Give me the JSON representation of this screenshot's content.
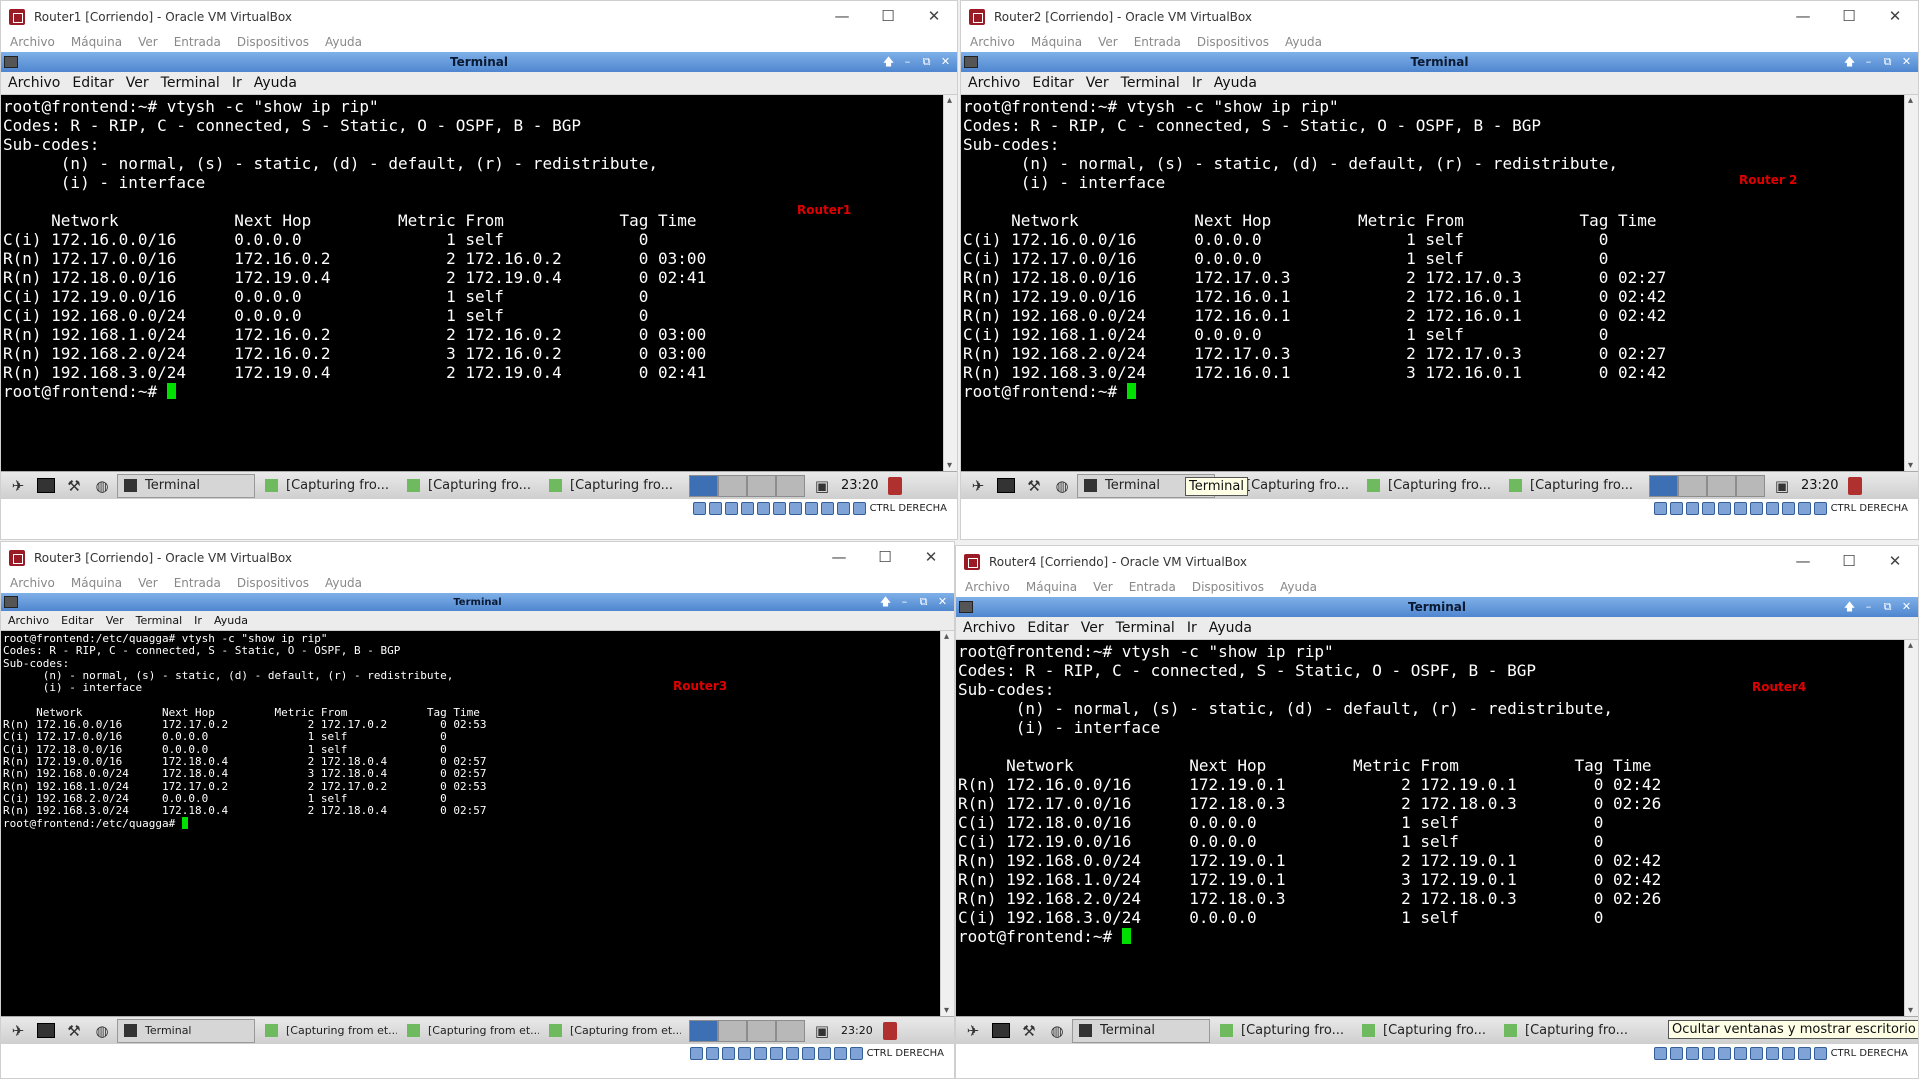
{
  "colors": {
    "terminal_bg": "#000000",
    "terminal_fg": "#ffffff",
    "cursor": "#00e000",
    "label_red": "#e00000",
    "titlebar_blue": "#4f86cf"
  },
  "vbox_menu": [
    "Archivo",
    "Máquina",
    "Ver",
    "Entrada",
    "Dispositivos",
    "Ayuda"
  ],
  "term_menu": [
    "Archivo",
    "Editar",
    "Ver",
    "Terminal",
    "Ir",
    "Ayuda"
  ],
  "term_window_title": "Terminal",
  "host_key": "CTRL DERECHA",
  "panel_clock": "23:20",
  "win_controls": [
    "—",
    "☐",
    "✕"
  ],
  "vms": [
    {
      "window_title": "Router1 [Corriendo] - Oracle VM VirtualBox",
      "label": "Router1",
      "lines": [
        "root@frontend:~# vtysh -c \"show ip rip\"",
        "Codes: R - RIP, C - connected, S - Static, O - OSPF, B - BGP",
        "Sub-codes:",
        "      (n) - normal, (s) - static, (d) - default, (r) - redistribute,",
        "      (i) - interface",
        "",
        "     Network            Next Hop         Metric From            Tag Time",
        "C(i) 172.16.0.0/16      0.0.0.0               1 self              0",
        "R(n) 172.17.0.0/16      172.16.0.2            2 172.16.0.2        0 03:00",
        "R(n) 172.18.0.0/16      172.19.0.4            2 172.19.0.4        0 02:41",
        "C(i) 172.19.0.0/16      0.0.0.0               1 self              0",
        "C(i) 192.168.0.0/24     0.0.0.0               1 self              0",
        "R(n) 192.168.1.0/24     172.16.0.2            2 172.16.0.2        0 03:00",
        "R(n) 192.168.2.0/24     172.16.0.2            3 172.16.0.2        0 03:00",
        "R(n) 192.168.3.0/24     172.19.0.4            2 172.19.0.4        0 02:41"
      ],
      "prompt": "root@frontend:~# ",
      "tasks": [
        "Terminal",
        "[Capturing fro...",
        "[Capturing fro...",
        "[Capturing fro..."
      ]
    },
    {
      "window_title": "Router2 [Corriendo] - Oracle VM VirtualBox",
      "label": "Router 2",
      "lines": [
        "root@frontend:~# vtysh -c \"show ip rip\"",
        "Codes: R - RIP, C - connected, S - Static, O - OSPF, B - BGP",
        "Sub-codes:",
        "      (n) - normal, (s) - static, (d) - default, (r) - redistribute,",
        "      (i) - interface",
        "",
        "     Network            Next Hop         Metric From            Tag Time",
        "C(i) 172.16.0.0/16      0.0.0.0               1 self              0",
        "C(i) 172.17.0.0/16      0.0.0.0               1 self              0",
        "R(n) 172.18.0.0/16      172.17.0.3            2 172.17.0.3        0 02:27",
        "R(n) 172.19.0.0/16      172.16.0.1            2 172.16.0.1        0 02:42",
        "R(n) 192.168.0.0/24     172.16.0.1            2 172.16.0.1        0 02:42",
        "C(i) 192.168.1.0/24     0.0.0.0               1 self              0",
        "R(n) 192.168.2.0/24     172.17.0.3            2 172.17.0.3        0 02:27",
        "R(n) 192.168.3.0/24     172.16.0.1            3 172.16.0.1        0 02:42"
      ],
      "prompt": "root@frontend:~# ",
      "tasks": [
        "Terminal",
        "[Capturing fro...",
        "[Capturing fro...",
        "[Capturing fro..."
      ],
      "tooltip": "Terminal"
    },
    {
      "window_title": "Router3 [Corriendo] - Oracle VM VirtualBox",
      "label": "Router3",
      "lines": [
        "root@frontend:/etc/quagga# vtysh -c \"show ip rip\"",
        "Codes: R - RIP, C - connected, S - Static, O - OSPF, B - BGP",
        "Sub-codes:",
        "      (n) - normal, (s) - static, (d) - default, (r) - redistribute,",
        "      (i) - interface",
        "",
        "     Network            Next Hop         Metric From            Tag Time",
        "R(n) 172.16.0.0/16      172.17.0.2            2 172.17.0.2        0 02:53",
        "C(i) 172.17.0.0/16      0.0.0.0               1 self              0",
        "C(i) 172.18.0.0/16      0.0.0.0               1 self              0",
        "R(n) 172.19.0.0/16      172.18.0.4            2 172.18.0.4        0 02:57",
        "R(n) 192.168.0.0/24     172.18.0.4            3 172.18.0.4        0 02:57",
        "R(n) 192.168.1.0/24     172.17.0.2            2 172.17.0.2        0 02:53",
        "C(i) 192.168.2.0/24     0.0.0.0               1 self              0",
        "R(n) 192.168.3.0/24     172.18.0.4            2 172.18.0.4        0 02:57"
      ],
      "prompt": "root@frontend:/etc/quagga# ",
      "tasks": [
        "Terminal",
        "[Capturing from et...",
        "[Capturing from et...",
        "[Capturing from et..."
      ]
    },
    {
      "window_title": "Router4 [Corriendo] - Oracle VM VirtualBox",
      "label": "Router4",
      "lines": [
        "root@frontend:~# vtysh -c \"show ip rip\"",
        "Codes: R - RIP, C - connected, S - Static, O - OSPF, B - BGP",
        "Sub-codes:",
        "      (n) - normal, (s) - static, (d) - default, (r) - redistribute,",
        "      (i) - interface",
        "",
        "     Network            Next Hop         Metric From            Tag Time",
        "R(n) 172.16.0.0/16      172.19.0.1            2 172.19.0.1        0 02:42",
        "R(n) 172.17.0.0/16      172.18.0.3            2 172.18.0.3        0 02:26",
        "C(i) 172.18.0.0/16      0.0.0.0               1 self              0",
        "C(i) 172.19.0.0/16      0.0.0.0               1 self              0",
        "R(n) 192.168.0.0/24     172.19.0.1            2 172.19.0.1        0 02:42",
        "R(n) 192.168.1.0/24     172.19.0.1            3 172.19.0.1        0 02:42",
        "R(n) 192.168.2.0/24     172.18.0.3            2 172.18.0.3        0 02:26",
        "C(i) 192.168.3.0/24     0.0.0.0               1 self              0"
      ],
      "prompt": "root@frontend:~# ",
      "tasks": [
        "Terminal",
        "[Capturing fro...",
        "[Capturing fro...",
        "[Capturing fro..."
      ],
      "tooltip": "Ocultar ventanas y mostrar escritorio"
    }
  ]
}
